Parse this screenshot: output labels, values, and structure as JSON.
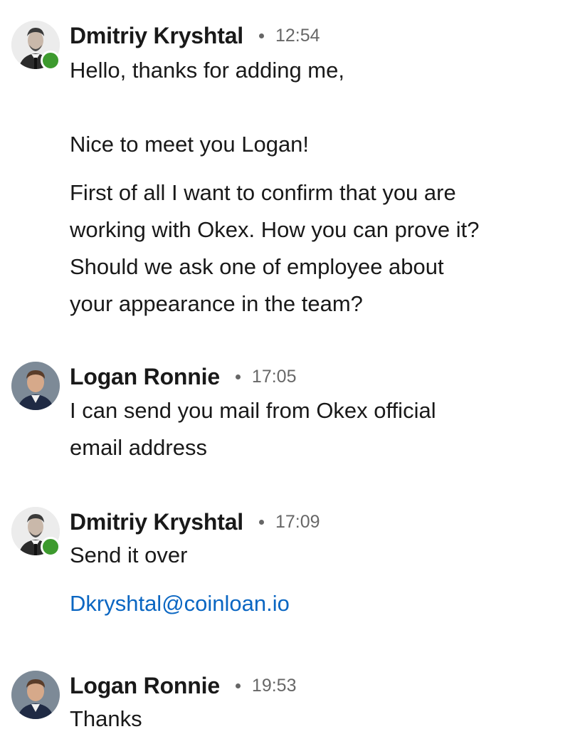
{
  "colors": {
    "link": "#0a66c2",
    "presence_online": "#3d9a2e",
    "text_primary": "rgba(0,0,0,0.9)",
    "text_secondary": "rgba(0,0,0,0.6)"
  },
  "messages": [
    {
      "sender": "Dmitriy Kryshtal",
      "time": "12:54",
      "online": true,
      "lines": [
        "Hello, thanks for adding me,",
        "Nice to meet you Logan!",
        "First of all I want to confirm that you are",
        "working with Okex. How you can prove it?",
        "Should we ask one of employee about",
        "your appearance in the team?"
      ]
    },
    {
      "sender": "Logan Ronnie",
      "time": "17:05",
      "online": false,
      "lines": [
        "I  can send you mail from Okex official",
        "email address"
      ]
    },
    {
      "sender": "Dmitriy Kryshtal",
      "time": "17:09",
      "online": true,
      "lines": [
        "Send it over"
      ],
      "link": "Dkryshtal@coinloan.io"
    },
    {
      "sender": "Logan Ronnie",
      "time": "19:53",
      "online": false,
      "lines": [
        "Thanks"
      ]
    }
  ]
}
